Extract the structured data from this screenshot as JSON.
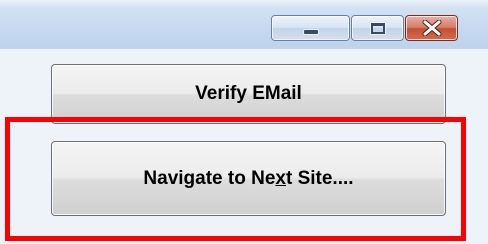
{
  "window": {
    "controls": {
      "minimize_icon": "minimize-icon",
      "maximize_icon": "maximize-icon",
      "close_icon": "close-icon"
    }
  },
  "buttons": {
    "verify_email": "Verify EMail",
    "navigate_before": "Navigate to Ne",
    "navigate_mnemonic": "x",
    "navigate_after": "t Site...."
  },
  "colors": {
    "highlight_border": "#ff0000",
    "close_button": "#c34f33",
    "titlebar": "#c9dbf1"
  }
}
